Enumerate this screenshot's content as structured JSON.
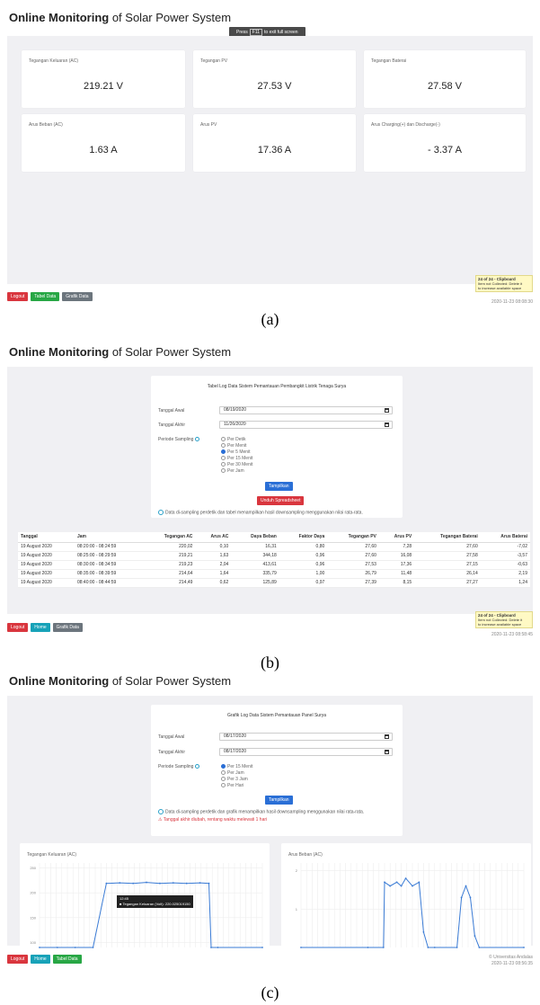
{
  "app_title_bold": "Online Monitoring",
  "app_title_rest": " of Solar Power System",
  "panel_a": {
    "caption": "(a)",
    "toast": {
      "pre": "Press",
      "key": "F11",
      "post": "to exit full screen"
    },
    "cards": [
      {
        "label": "Tegangan Keluaran (AC)",
        "value": "219.21 V"
      },
      {
        "label": "Tegangan PV",
        "value": "27.53 V"
      },
      {
        "label": "Tegangan Baterai",
        "value": "27.58 V"
      },
      {
        "label": "Arus Beban (AC)",
        "value": "1.63 A"
      },
      {
        "label": "Arus PV",
        "value": "17.36 A"
      },
      {
        "label": "Arus Charging(+) dan Discharge(-)",
        "value": "- 3.37 A"
      }
    ],
    "buttons": [
      "Logout",
      "Tabel Data",
      "Grafik Data"
    ],
    "clipboard": {
      "title": "24 of 24 - Clipboard",
      "line1": "Item not Collected: Delete it",
      "line2": "to increase available space"
    },
    "timestamp": "2020-11-23 08:08:30"
  },
  "panel_b": {
    "caption": "(b)",
    "form_title": "Tabel Log Data Sistem Pemantauan Pembangkit Listrik Tenaga Surya",
    "tanggal_awal_label": "Tanggal Awal",
    "tanggal_awal": "08/19/2020",
    "tanggal_akhir_label": "Tanggal Akhir",
    "tanggal_akhir": "11/26/2020",
    "periode_label": "Periode Sampling",
    "options": [
      "Per Detik",
      "Per Menit",
      "Per 5 Menit",
      "Per 15 Menit",
      "Per 30 Menit",
      "Per Jam"
    ],
    "selected_option": "Per 5 Menit",
    "show_button": "Tampilkan",
    "download_button": "Unduh Spreadsheet",
    "note": "Data di-sampling perdetik dan tabel menampilkan hasil downsampling menggunakan nilai rata-rata.",
    "table_headers": [
      "Tanggal",
      "Jam",
      "Tegangan AC",
      "Arus AC",
      "Daya Beban",
      "Faktor Daya",
      "Tegangan PV",
      "Arus PV",
      "Tegangan Baterai",
      "Arus Baterai"
    ],
    "rows": [
      [
        "19 August 2020",
        "08:20:00 - 08:24:59",
        "220,02",
        "0,10",
        "16,31",
        "0,80",
        "27,60",
        "7,28",
        "27,60",
        "-7,02"
      ],
      [
        "19 August 2020",
        "08:25:00 - 08:29:59",
        "219,21",
        "1,63",
        "344,18",
        "0,96",
        "27,60",
        "16,08",
        "27,58",
        "-3,57"
      ],
      [
        "19 August 2020",
        "08:30:00 - 08:34:59",
        "219,23",
        "2,04",
        "413,61",
        "0,96",
        "27,53",
        "17,36",
        "27,15",
        "-0,63"
      ],
      [
        "19 August 2020",
        "08:35:00 - 08:39:59",
        "214,64",
        "1,64",
        "335,79",
        "1,00",
        "26,79",
        "11,48",
        "26,14",
        "2,19"
      ],
      [
        "19 August 2020",
        "08:40:00 - 08:44:59",
        "214,49",
        "0,62",
        "125,89",
        "0,97",
        "27,39",
        "8,15",
        "27,27",
        "1,24"
      ]
    ],
    "buttons": [
      "Logout",
      "Home",
      "Grafik Data"
    ],
    "clipboard": {
      "title": "24 of 24 - Clipboard",
      "line1": "Item not Collected: Delete it",
      "line2": "to increase available space"
    },
    "timestamp": "2020-11-23 08:58:45"
  },
  "panel_c": {
    "caption": "(c)",
    "form_title": "Grafik Log Data Sistem Pemantauan Panel Surya",
    "tanggal_awal_label": "Tanggal Awal",
    "tanggal_awal": "08/17/2020",
    "tanggal_akhir_label": "Tanggal Akhir",
    "tanggal_akhir": "08/17/2020",
    "periode_label": "Periode Sampling",
    "options": [
      "Per 15 Menit",
      "Per Jam",
      "Per 3 Jam",
      "Per Hari"
    ],
    "selected_option": "Per 15 Menit",
    "show_button": "Tampilkan",
    "note": "Data di-sampling perdetik dan grafik menampilkan hasil downsampling menggunakan nilai rata-rata.",
    "warning": "Tanggal akhir diubah, rentang waktu melewati 1 hari",
    "buttons": [
      "Logout",
      "Home",
      "Tabel Data"
    ],
    "footer_brand": "© Universitas Andalas",
    "timestamp": "2020-11-23 08:56:35"
  },
  "chart_data": [
    {
      "type": "line",
      "title": "Tegangan Keluaran (AC)",
      "yticks": [
        250,
        200,
        150,
        100
      ],
      "ylim": [
        90,
        260
      ],
      "x": [
        0,
        0.08,
        0.16,
        0.24,
        0.3,
        0.36,
        0.42,
        0.48,
        0.54,
        0.6,
        0.66,
        0.72,
        0.76,
        0.77,
        0.8,
        1.0
      ],
      "series": [
        {
          "name": "Tegangan Keluaran (Volt)",
          "values": [
            90,
            90,
            90,
            90,
            219,
            220,
            219,
            221,
            219,
            220,
            219,
            220,
            219,
            90,
            90,
            90
          ]
        }
      ],
      "tooltip": {
        "time": "12:45",
        "label": "Tegangan Keluaran (Volt)",
        "value": "220.025019150"
      },
      "grid": true
    },
    {
      "type": "line",
      "title": "Arus Beban (AC)",
      "yticks": [
        2,
        1
      ],
      "ylim": [
        0,
        2.2
      ],
      "x": [
        0,
        0.3,
        0.37,
        0.375,
        0.4,
        0.43,
        0.45,
        0.47,
        0.5,
        0.53,
        0.55,
        0.57,
        0.6,
        0.7,
        0.72,
        0.74,
        0.76,
        0.78,
        0.8,
        1.0
      ],
      "series": [
        {
          "name": "Arus Beban (AC)",
          "values": [
            0,
            0,
            0,
            1.7,
            1.6,
            1.7,
            1.6,
            1.8,
            1.6,
            1.7,
            0.4,
            0,
            0,
            0,
            1.3,
            1.6,
            1.3,
            0.3,
            0,
            0
          ]
        }
      ],
      "grid": true
    }
  ]
}
